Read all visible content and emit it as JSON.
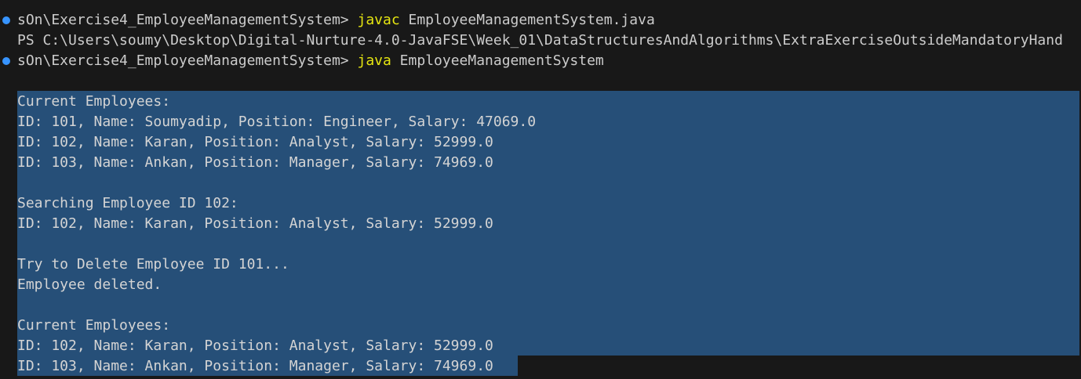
{
  "terminal": {
    "colors": {
      "background": "#181818",
      "selection": "#264f78",
      "command_keyword": "#e5e510",
      "status_dot": "#3794ff"
    },
    "line1": {
      "prompt": "sOn\\Exercise4_EmployeeManagementSystem> ",
      "command": "javac",
      "args": " EmployeeManagementSystem.java"
    },
    "line2": {
      "text": "PS C:\\Users\\soumy\\Desktop\\Digital-Nurture-4.0-JavaFSE\\Week_01\\DataStructuresAndAlgorithms\\ExtraExerciseOutsideMandatoryHand"
    },
    "line3": {
      "prompt": "sOn\\Exercise4_EmployeeManagementSystem> ",
      "command": "java",
      "args": " EmployeeManagementSystem"
    },
    "output": [
      "Current Employees:",
      "ID: 101, Name: Soumyadip, Position: Engineer, Salary: 47069.0",
      "ID: 102, Name: Karan, Position: Analyst, Salary: 52999.0",
      "ID: 103, Name: Ankan, Position: Manager, Salary: 74969.0",
      "",
      "Searching Employee ID 102:",
      "ID: 102, Name: Karan, Position: Analyst, Salary: 52999.0",
      "",
      "Try to Delete Employee ID 101...",
      "Employee deleted.",
      "",
      "Current Employees:",
      "ID: 102, Name: Karan, Position: Analyst, Salary: 52999.0",
      "ID: 103, Name: Ankan, Position: Manager, Salary: 74969.0"
    ]
  }
}
